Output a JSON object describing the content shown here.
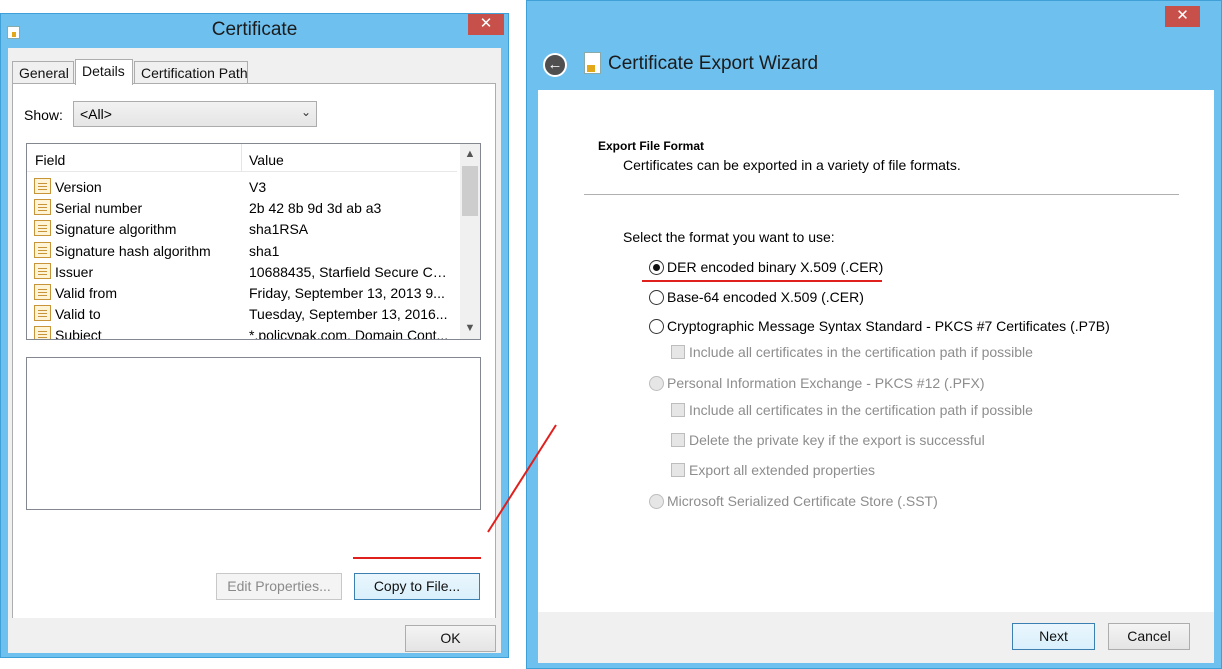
{
  "certificate": {
    "title": "Certificate",
    "close_glyph": "✕",
    "tabs": [
      "General",
      "Details",
      "Certification Path"
    ],
    "show_label": "Show:",
    "show_value": "<All>",
    "columns": [
      "Field",
      "Value"
    ],
    "rows": [
      {
        "field": "Version",
        "value": "V3"
      },
      {
        "field": "Serial number",
        "value": "2b 42 8b 9d 3d ab a3"
      },
      {
        "field": "Signature algorithm",
        "value": "sha1RSA"
      },
      {
        "field": "Signature hash algorithm",
        "value": "sha1"
      },
      {
        "field": "Issuer",
        "value": "10688435, Starfield Secure Ce..."
      },
      {
        "field": "Valid from",
        "value": "Friday, September 13, 2013 9..."
      },
      {
        "field": "Valid to",
        "value": "Tuesday, September 13, 2016..."
      },
      {
        "field": "Subject",
        "value": "*.policypak.com, Domain Cont..."
      }
    ],
    "edit_properties_label": "Edit Properties...",
    "copy_to_file_label": "Copy to File...",
    "ok_label": "OK"
  },
  "wizard": {
    "title": "Certificate Export Wizard",
    "close_glyph": "✕",
    "back_glyph": "←",
    "section_title": "Export File Format",
    "section_desc": "Certificates can be exported in a variety of file formats.",
    "prompt": "Select the format you want to use:",
    "options": [
      {
        "label": "DER encoded binary X.509 (.CER)",
        "checked": true,
        "enabled": true
      },
      {
        "label": "Base-64 encoded X.509 (.CER)",
        "checked": false,
        "enabled": true
      },
      {
        "label": "Cryptographic Message Syntax Standard - PKCS #7 Certificates (.P7B)",
        "checked": false,
        "enabled": true
      },
      {
        "label": "Personal Information Exchange - PKCS #12 (.PFX)",
        "checked": false,
        "enabled": false
      },
      {
        "label": "Microsoft Serialized Certificate Store (.SST)",
        "checked": false,
        "enabled": false
      }
    ],
    "checkboxes": [
      {
        "label": "Include all certificates in the certification path if possible"
      },
      {
        "label": "Include all certificates in the certification path if possible"
      },
      {
        "label": "Delete the private key if the export is successful"
      },
      {
        "label": "Export all extended properties"
      }
    ],
    "next_label": "Next",
    "cancel_label": "Cancel"
  },
  "colors": {
    "title_bar": "#6ec0ee",
    "close_button": "#c7504a",
    "annotation": "#e0201d"
  }
}
